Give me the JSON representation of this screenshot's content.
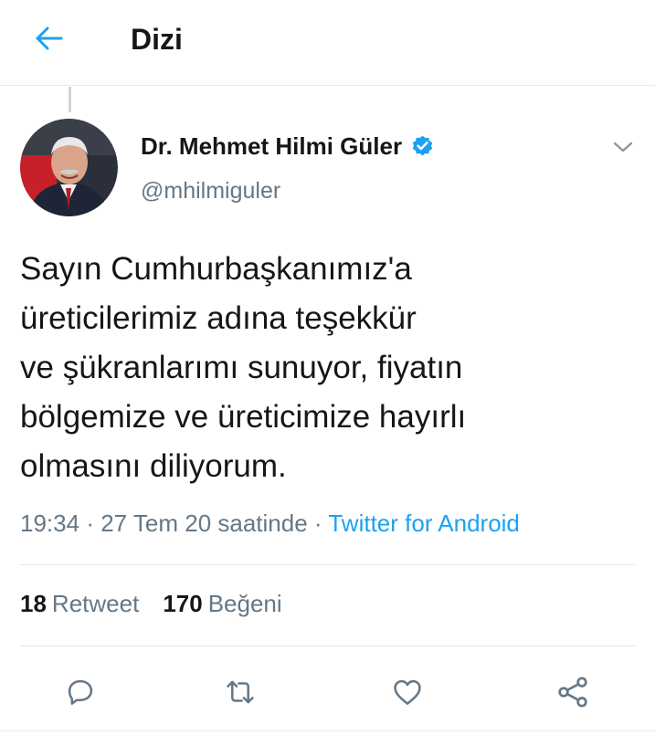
{
  "header": {
    "title": "Dizi",
    "back_icon": "arrow-left-icon"
  },
  "colors": {
    "accent": "#1da1f2",
    "text_primary": "#14171a",
    "text_secondary": "#657786",
    "divider": "#e1e8ed"
  },
  "tweet": {
    "author_name": "Dr. Mehmet Hilmi Güler",
    "verified": true,
    "handle": "@mhilmiguler",
    "text": "Sayın Cumhurbaşkanımız'a\nüreticilerimiz adına teşekkür\nve şükranlarımı sunuyor, fiyatın\nbölgemize ve üreticimize hayırlı\nolmasını diliyorum.",
    "time": "19:34",
    "date": "27 Tem 20 saatinde",
    "separator": "·",
    "source": "Twitter for Android"
  },
  "stats": {
    "retweets_count": "18",
    "retweets_label": "Retweet",
    "likes_count": "170",
    "likes_label": "Beğeni"
  },
  "actions": [
    {
      "icon": "reply-icon"
    },
    {
      "icon": "retweet-icon"
    },
    {
      "icon": "like-icon"
    },
    {
      "icon": "share-icon"
    }
  ]
}
